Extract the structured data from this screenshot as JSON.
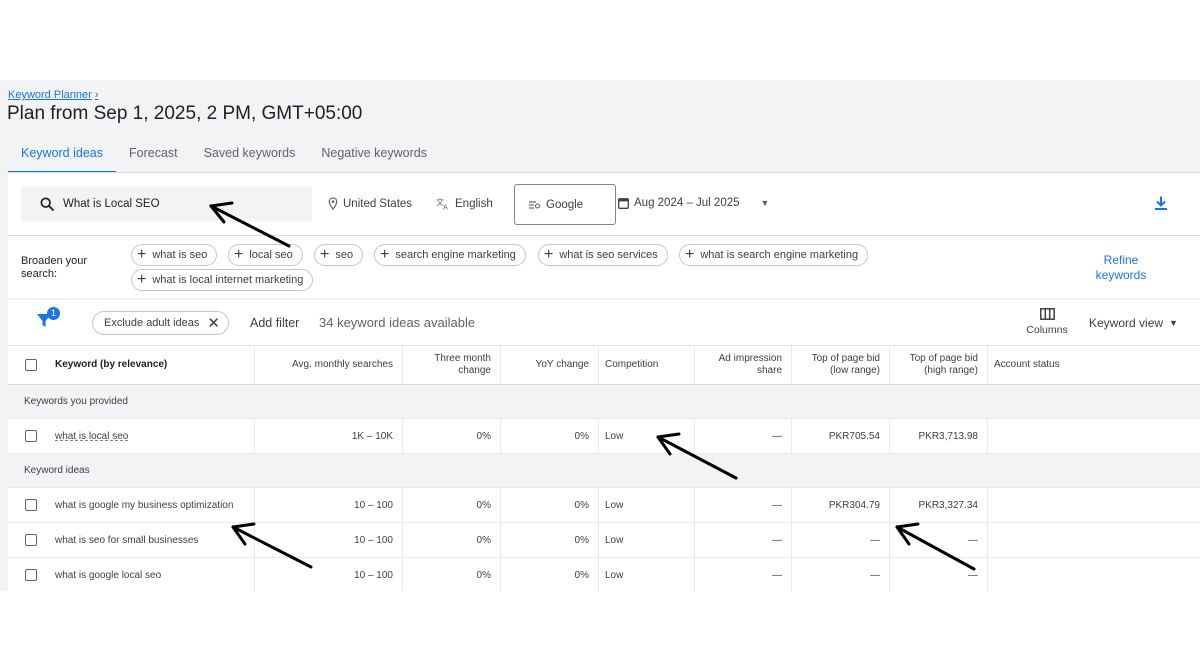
{
  "breadcrumb": {
    "label": "Keyword Planner",
    "chevron": "›"
  },
  "page_title": "Plan from Sep 1, 2025, 2 PM, GMT+05:00",
  "tabs": [
    {
      "label": "Keyword ideas",
      "active": true
    },
    {
      "label": "Forecast",
      "active": false
    },
    {
      "label": "Saved keywords",
      "active": false
    },
    {
      "label": "Negative keywords",
      "active": false
    }
  ],
  "search": {
    "value": "What is Local SEO",
    "icon": "search-icon"
  },
  "filters": {
    "location": "United States",
    "language": "English",
    "network": "Google",
    "date_range": "Aug 2024 – Jul 2025"
  },
  "broaden": {
    "label_line1": "Broaden your",
    "label_line2": "search:",
    "chips": [
      "what is seo",
      "local seo",
      "seo",
      "search engine marketing",
      "what is seo services",
      "what is search engine marketing",
      "what is local internet marketing"
    ],
    "refine_line1": "Refine",
    "refine_line2": "keywords"
  },
  "toolbar": {
    "filter_badge": "1",
    "adult_chip": "Exclude adult ideas",
    "add_filter": "Add filter",
    "ideas_count": "34 keyword ideas available",
    "columns": "Columns",
    "view": "Keyword view"
  },
  "table": {
    "headers": {
      "keyword": "Keyword (by relevance)",
      "avg": "Avg. monthly searches",
      "three_month_1": "Three month",
      "three_month_2": "change",
      "yoy": "YoY change",
      "competition": "Competition",
      "ad_impr_1": "Ad impression",
      "ad_impr_2": "share",
      "top_low_1": "Top of page bid",
      "top_low_2": "(low range)",
      "top_high_1": "Top of page bid",
      "top_high_2": "(high range)",
      "status": "Account status"
    },
    "section_provided": "Keywords you provided",
    "section_ideas": "Keyword ideas",
    "provided_rows": [
      {
        "keyword": "what is local seo",
        "avg": "1K – 10K",
        "three_month": "0%",
        "yoy": "0%",
        "competition": "Low",
        "ad_share": "—",
        "bid_low": "PKR705.54",
        "bid_high": "PKR3,713.98"
      }
    ],
    "idea_rows": [
      {
        "keyword": "what is google my business optimization",
        "avg": "10 – 100",
        "three_month": "0%",
        "yoy": "0%",
        "competition": "Low",
        "ad_share": "—",
        "bid_low": "PKR304.79",
        "bid_high": "PKR3,327.34"
      },
      {
        "keyword": "what is seo for small businesses",
        "avg": "10 – 100",
        "three_month": "0%",
        "yoy": "0%",
        "competition": "Low",
        "ad_share": "—",
        "bid_low": "—",
        "bid_high": "—"
      },
      {
        "keyword": "what is google local seo",
        "avg": "10 – 100",
        "three_month": "0%",
        "yoy": "0%",
        "competition": "Low",
        "ad_share": "—",
        "bid_low": "—",
        "bid_high": "—"
      }
    ]
  },
  "colors": {
    "accent": "#1a73e8",
    "background": "#f1f3f4",
    "arrow": "#000000"
  }
}
